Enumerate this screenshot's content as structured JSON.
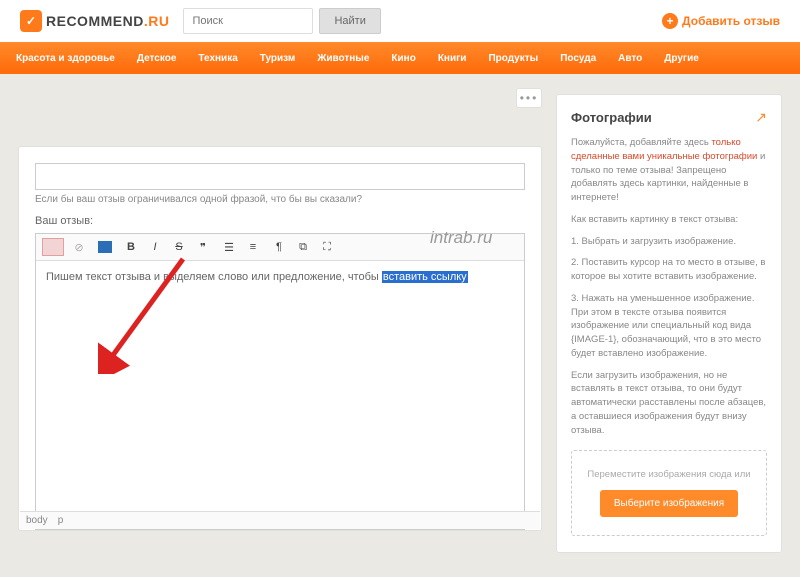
{
  "header": {
    "logo1": "RECOMMEND",
    "logo2": ".RU",
    "search_placeholder": "Поиск",
    "find": "Найти",
    "add_review": "Добавить отзыв"
  },
  "nav": [
    "Красота и здоровье",
    "Детское",
    "Техника",
    "Туризм",
    "Животные",
    "Кино",
    "Книги",
    "Продукты",
    "Посуда",
    "Авто",
    "Другие"
  ],
  "editor": {
    "title_hint": "Если бы ваш отзыв ограничивался одной фразой, что бы вы сказали?",
    "body_label": "Ваш отзыв:",
    "content_plain": "Пишем текст отзыва и выделяем слово или предложение, чтобы ",
    "content_selected": "вставить ссылку",
    "status": [
      "body",
      "p"
    ]
  },
  "side": {
    "title": "Фотографии",
    "p1a": "Пожалуйста, добавляйте здесь",
    "p1b": "только сделанные вами уникальные фотографии",
    "p1c": "и только по теме отзыва! Запрещено добавлять здесь картинки, найденные в интернете!",
    "p2": "Как вставить картинку в текст отзыва:",
    "p3": "1. Выбрать и загрузить изображение.",
    "p4": "2. Поставить курсор на то место в отзыве, в которое вы хотите вставить изображение.",
    "p5": "3. Нажать на уменьшенное изображение. При этом в тексте отзыва появится изображение или специальный код вида {IMAGE-1}, обозначающий, что в это место будет вставлено изображение.",
    "p6": "Если загрузить изображения, но не вставлять в текст отзыва, то они будут автоматически расставлены после абзацев, а оставшиеся изображения будут внизу отзыва.",
    "drop_text": "Переместите изображения сюда или",
    "choose_btn": "Выберите изображения"
  },
  "watermark": "intrab.ru"
}
